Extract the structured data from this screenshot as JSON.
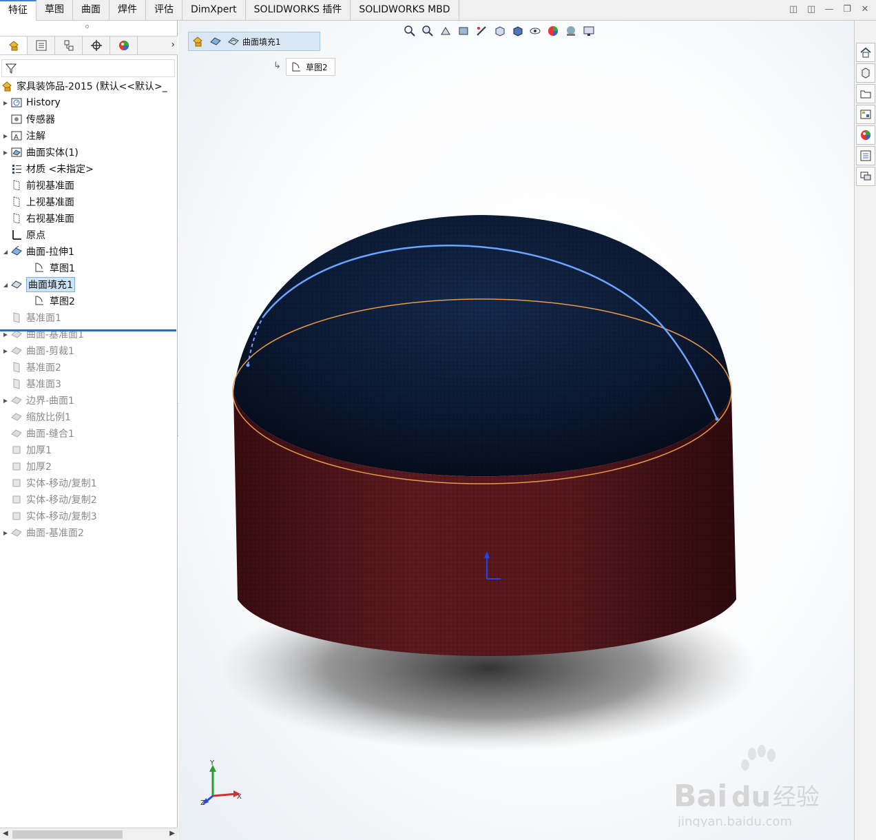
{
  "tabs": [
    "特征",
    "草图",
    "曲面",
    "焊件",
    "评估",
    "DimXpert",
    "SOLIDWORKS 插件",
    "SOLIDWORKS MBD"
  ],
  "active_tab": 0,
  "tree": {
    "root": "家具装饰品-2015  (默认<<默认>_",
    "items": [
      {
        "label": "History",
        "exp": true,
        "dim": false
      },
      {
        "label": "传感器",
        "exp": false,
        "dim": false
      },
      {
        "label": "注解",
        "exp": true,
        "dim": false
      },
      {
        "label": "曲面实体(1)",
        "exp": true,
        "dim": false
      },
      {
        "label": "材质 <未指定>",
        "exp": false,
        "dim": false
      },
      {
        "label": "前视基准面",
        "exp": false,
        "dim": false
      },
      {
        "label": "上视基准面",
        "exp": false,
        "dim": false
      },
      {
        "label": "右视基准面",
        "exp": false,
        "dim": false
      },
      {
        "label": "原点",
        "exp": false,
        "dim": false
      },
      {
        "label": "曲面-拉伸1",
        "exp": true,
        "dim": false
      },
      {
        "label": "草图1",
        "exp": false,
        "dim": false
      },
      {
        "label": "曲面填充1",
        "exp": true,
        "dim": false
      },
      {
        "label": "草图2",
        "exp": false,
        "dim": false
      },
      {
        "label": "基准面1",
        "exp": false,
        "dim": true
      },
      {
        "label": "曲面-基准面1",
        "exp": true,
        "dim": true
      },
      {
        "label": "曲面-剪裁1",
        "exp": true,
        "dim": true
      },
      {
        "label": "基准面2",
        "exp": false,
        "dim": true
      },
      {
        "label": "基准面3",
        "exp": false,
        "dim": true
      },
      {
        "label": "边界-曲面1",
        "exp": true,
        "dim": true
      },
      {
        "label": "缩放比例1",
        "exp": false,
        "dim": true
      },
      {
        "label": "曲面-缝合1",
        "exp": false,
        "dim": true
      },
      {
        "label": "加厚1",
        "exp": false,
        "dim": true
      },
      {
        "label": "加厚2",
        "exp": false,
        "dim": true
      },
      {
        "label": "实体-移动/复制1",
        "exp": false,
        "dim": true
      },
      {
        "label": "实体-移动/复制2",
        "exp": false,
        "dim": true
      },
      {
        "label": "实体-移动/复制3",
        "exp": false,
        "dim": true
      },
      {
        "label": "曲面-基准面2",
        "exp": true,
        "dim": true
      }
    ]
  },
  "breadcrumb": {
    "label": "曲面填充1",
    "child": "草图2"
  },
  "triad": {
    "x": "X",
    "y": "Y",
    "z": "Z"
  },
  "watermark": {
    "brand": "Bai",
    "brand2": "du",
    "cn": "经验",
    "url": "jingyan.baidu.com"
  },
  "colors": {
    "accent": "#3c7fd6",
    "top": "#0d1b33",
    "side": "#5a1a1e",
    "edge_blue": "#6aa6ff",
    "edge_orange": "#e89a4a"
  }
}
